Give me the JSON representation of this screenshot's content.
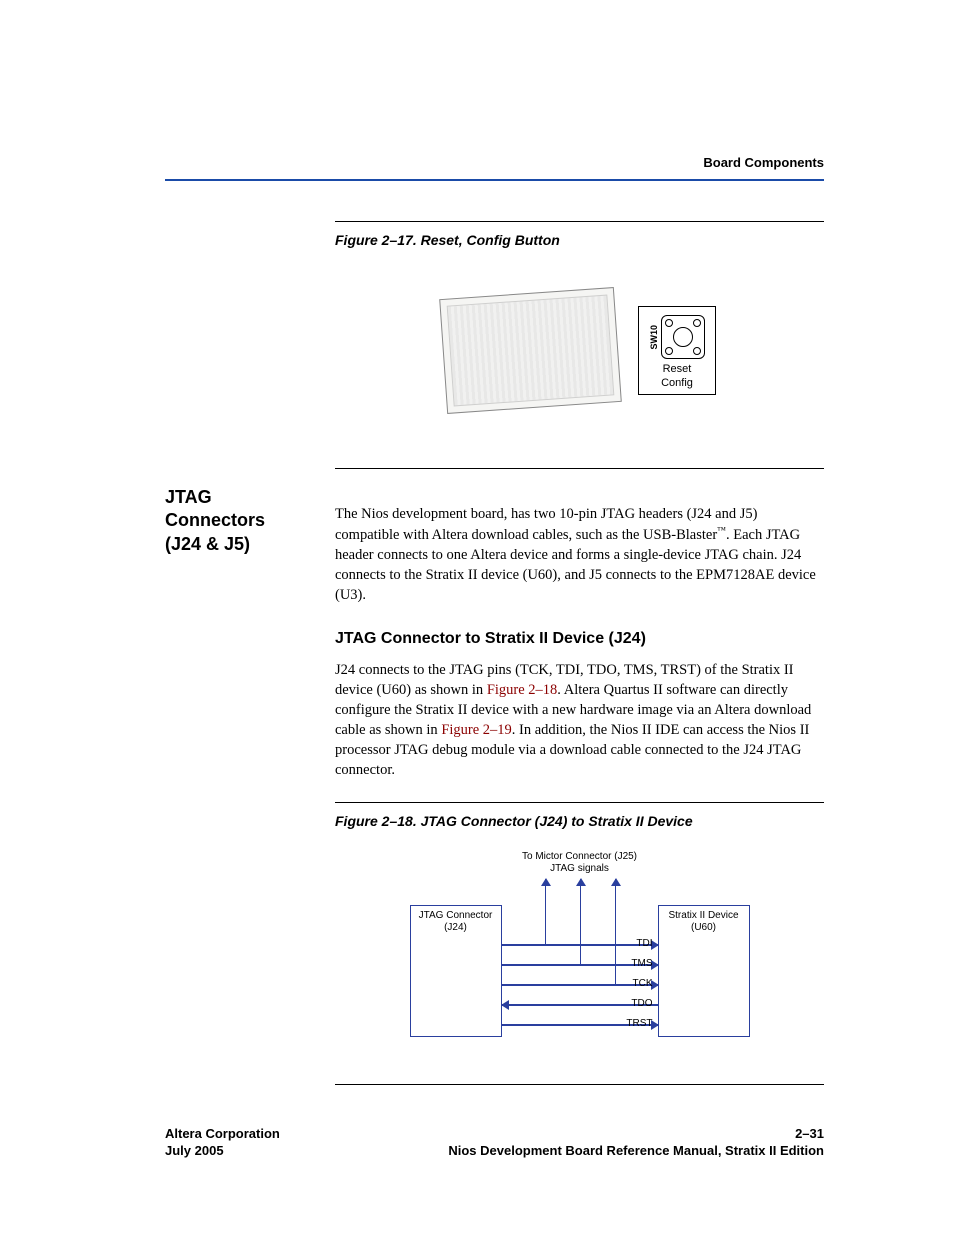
{
  "header": {
    "section": "Board Components"
  },
  "figures": {
    "f17": {
      "caption": "Figure 2–17. Reset, Config Button",
      "switch_id": "SW10",
      "btn_line1": "Reset",
      "btn_line2": "Config"
    },
    "f18": {
      "caption": "Figure 2–18. JTAG Connector (J24) to Stratix II Device",
      "top_line1": "To Mictor Connector (J25)",
      "top_line2": "JTAG signals",
      "left_line1": "JTAG Connector",
      "left_line2": "(J24)",
      "right_line1": "Stratix II Device",
      "right_line2": "(U60)",
      "sig1": "TDI",
      "sig2": "TMS",
      "sig3": "TCK",
      "sig4": "TDO",
      "sig5": "TRST"
    }
  },
  "sidebar": {
    "heading": "JTAG Connectors (J24 & J5)"
  },
  "body": {
    "intro_full": "The Nios development board, has two 10-pin JTAG headers (J24 and J5) compatible with Altera download cables, such as the USB-Blaster™. Each JTAG header connects to one Altera device and forms a single-device JTAG chain. J24 connects to the Stratix II device (U60), and J5 connects to the EPM7128AE device (U3).",
    "intro_p1": "The Nios development board, has two 10-pin JTAG headers (J24 and J5) compatible with Altera download cables, such as the USB-Blaster",
    "intro_p2": ". Each JTAG header connects to one Altera device and forms a single-device JTAG chain. J24 connects to the Stratix II device (U60), and J5 connects to the EPM7128AE device (U3).",
    "tm": "™",
    "subhead": "JTAG Connector to Stratix II Device (J24)",
    "para2_a": "J24 connects to the JTAG pins (TCK, TDI, TDO, TMS, TRST) of the Stratix II device (U60) as shown in ",
    "para2_link1": "Figure 2–18",
    "para2_b": ". Altera Quartus II software can directly configure the Stratix II device with a new hardware image via an Altera download cable as shown in ",
    "para2_link2": "Figure 2–19",
    "para2_c": ". In addition, the Nios II IDE can access the Nios II processor JTAG debug module via a download cable connected to the J24 JTAG connector."
  },
  "footer": {
    "left_line1": "Altera Corporation",
    "left_line2": "July 2005",
    "right_line1": "2–31",
    "right_line2": "Nios Development Board Reference Manual, Stratix II Edition"
  }
}
